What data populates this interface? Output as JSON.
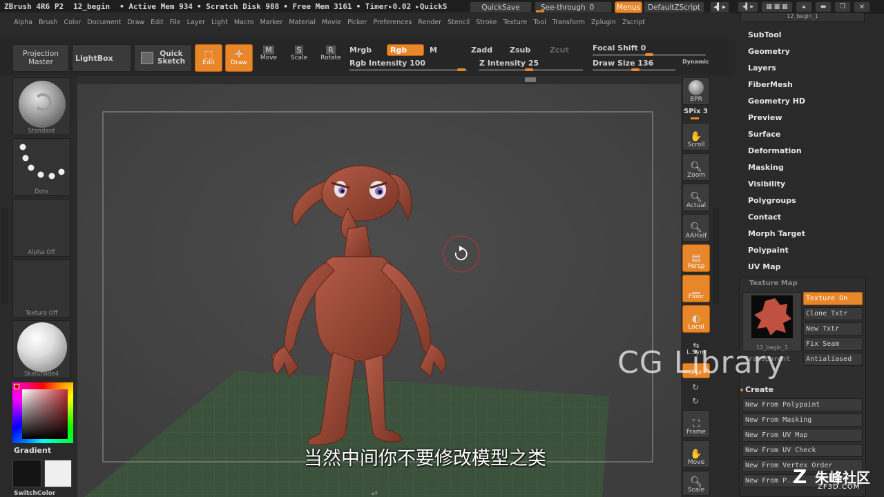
{
  "title_bar": {
    "app": "ZBrush 4R6 P2",
    "doc": "12_begin",
    "active_mem": "• Active Mem 934",
    "scratch": "• Scratch Disk 988",
    "free_mem": "• Free Mem 3161",
    "timer": "• Timer▸0.02",
    "quicks": "▸QuickS",
    "quicksave": "QuickSave",
    "see_through": "See-through",
    "see_through_val": "0",
    "menus": "Menus",
    "default_script": "DefaultZScript"
  },
  "menu": [
    "Alpha",
    "Brush",
    "Color",
    "Document",
    "Draw",
    "Edit",
    "File",
    "Layer",
    "Light",
    "Macro",
    "Marker",
    "Material",
    "Movie",
    "Picker",
    "Preferences",
    "Render",
    "Stencil",
    "Stroke",
    "Texture",
    "Tool",
    "Transform",
    "Zplugin",
    "Zscript"
  ],
  "toolbar": {
    "projection_master": "Projection\nMaster",
    "lightbox": "LightBox",
    "quick_sketch": "Quick\nSketch",
    "edit": "Edit",
    "draw": "Draw",
    "move": "Move",
    "scale": "Scale",
    "rotate": "Rotate",
    "mrgb": "Mrgb",
    "rgb": "Rgb",
    "m": "M",
    "zadd": "Zadd",
    "zsub": "Zsub",
    "zcut": "Zcut",
    "rgb_intensity": "Rgb Intensity 100",
    "z_intensity": "Z Intensity 25",
    "focal_shift": "Focal Shift 0",
    "draw_size": "Draw Size 136",
    "dynamic": "Dynamic"
  },
  "left_tray": {
    "brush": "Standard",
    "stroke": "Dots",
    "alpha": "Alpha Off",
    "texture": "Texture Off",
    "material": "SkinShade4",
    "gradient": "Gradient",
    "switch": "SwitchColor"
  },
  "right_tools": {
    "bpr": "BPR",
    "spix": "SPix 3",
    "scroll": "Scroll",
    "zoom": "Zoom",
    "actual": "Actual",
    "aahalf": "AAHalf",
    "persp": "Persp",
    "floor": "Floor",
    "local": "Local",
    "lsym": "L.Sym",
    "xyz": "Xyz",
    "frame": "Frame",
    "move": "Move",
    "scale": "Scale"
  },
  "panel": {
    "tool_name": "12_begin_1",
    "items": [
      "SubTool",
      "Geometry",
      "Layers",
      "FiberMesh",
      "Geometry HD",
      "Preview",
      "Surface",
      "Deformation",
      "Masking",
      "Visibility",
      "Polygroups",
      "Contact",
      "Morph Target",
      "Polypaint",
      "UV Map"
    ],
    "texture_map_title": "Texture Map",
    "texture_thumb_label": "12_begin_1",
    "texture_on": "Texture On",
    "clone_txtr": "Clone Txtr",
    "new_txtr": "New Txtr",
    "fix_seam": "Fix Seam",
    "transparent": "Transparent",
    "antialiased": "Antialiased",
    "create": "Create",
    "create_items": [
      "New From Polypaint",
      "New From Masking",
      "New From UV Map",
      "New From UV Check",
      "New From Vertex Order",
      "New From P..."
    ]
  },
  "overlay": {
    "watermark": "CG Library",
    "subtitle": "当然中间你不要修改模型之类",
    "logo": "朱峰社区",
    "logo_sub": "ZF3D.COM"
  },
  "colors": {
    "accent": "#e8862a",
    "ui_bg": "#2a2a2a",
    "canvas_bg": "#444444",
    "floor_grid": "#3f5a3f",
    "model_skin": "#9a4a38"
  }
}
